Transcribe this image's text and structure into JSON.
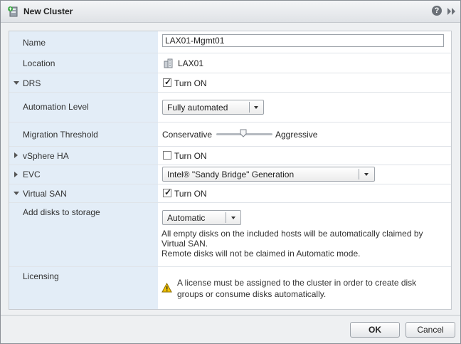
{
  "window": {
    "title": "New Cluster",
    "help_icon": "?"
  },
  "name": {
    "label": "Name",
    "value": "LAX01-Mgmt01"
  },
  "location": {
    "label": "Location",
    "value": "LAX01",
    "icon": "datacenter-icon"
  },
  "drs": {
    "label": "DRS",
    "checkbox_label": "Turn ON",
    "checked": true,
    "expanded": true
  },
  "automation_level": {
    "label": "Automation Level",
    "selected": "Fully automated"
  },
  "migration_threshold": {
    "label": "Migration Threshold",
    "left_label": "Conservative",
    "right_label": "Aggressive"
  },
  "vsphere_ha": {
    "label": "vSphere HA",
    "checkbox_label": "Turn ON",
    "checked": false,
    "expanded": false
  },
  "evc": {
    "label": "EVC",
    "selected": "Intel® \"Sandy Bridge\" Generation",
    "expanded": false
  },
  "virtual_san": {
    "label": "Virtual SAN",
    "checkbox_label": "Turn ON",
    "checked": true,
    "expanded": true
  },
  "add_disks": {
    "label": "Add disks to storage",
    "selected": "Automatic",
    "desc_line1": "All empty disks on the included hosts will be automatically claimed by",
    "desc_line2": "Virtual SAN.",
    "desc_line3": "Remote disks will not be claimed in Automatic mode."
  },
  "licensing": {
    "label": "Licensing",
    "warning_line1": "A license must be assigned to the cluster in order to create disk",
    "warning_line2": "groups or consume disks automatically."
  },
  "footer": {
    "ok_label": "OK",
    "cancel_label": "Cancel"
  },
  "colors": {
    "label_column": "#e3edf7",
    "warning": "#f2c200"
  }
}
